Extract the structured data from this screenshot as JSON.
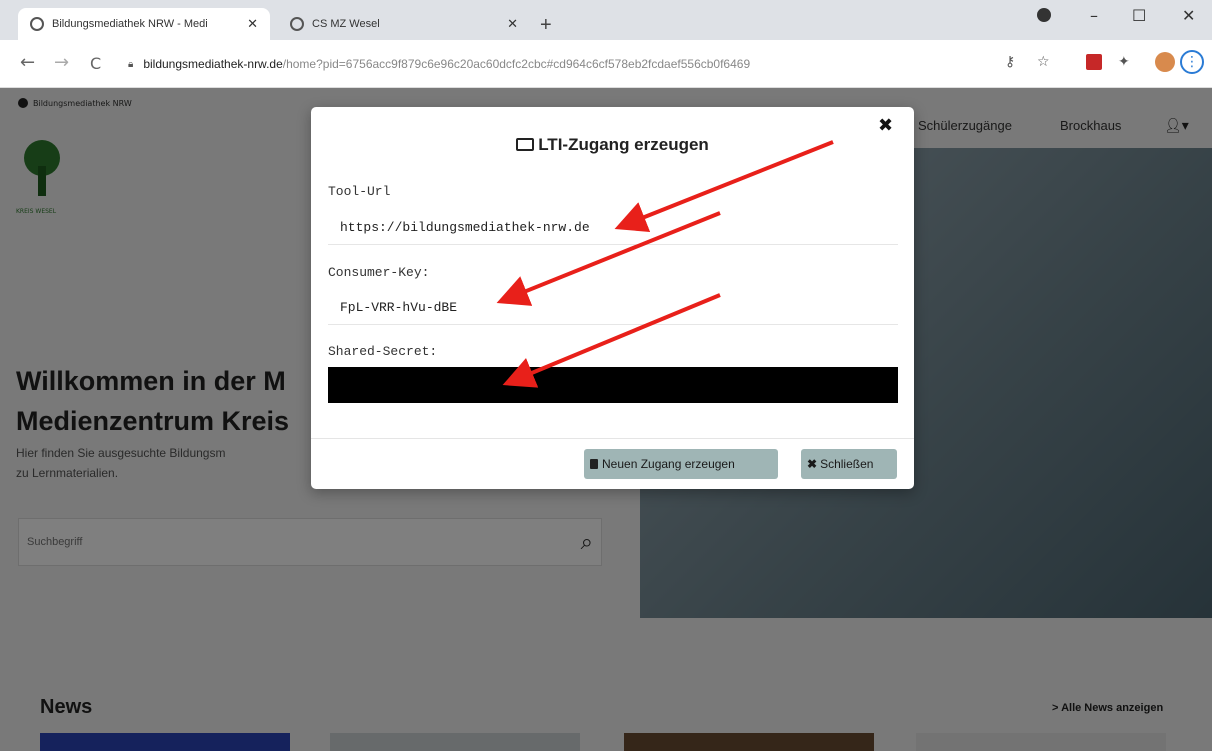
{
  "browser": {
    "tabs": [
      {
        "title": "Bildungsmediathek NRW - Medi"
      },
      {
        "title": "CS MZ Wesel"
      }
    ],
    "url_host": "bildungsmediathek-nrw.de",
    "url_path": "/home?pid=6756acc9f879c6e96c20ac60dcfc2cbc#cd964c6cf578eb2fcdaef556cb0f6469",
    "new_tab": "+",
    "win_min": "–",
    "win_max": "☐",
    "win_close": "✕"
  },
  "site": {
    "name": "Bildungsmediathek NRW",
    "logo_text": "KREIS WESEL",
    "nav": [
      "Schülerzugänge",
      "Brockhaus"
    ],
    "heading_line1": "Willkommen in der M",
    "heading_line2": "Medienzentrum Kreis",
    "subtext_line1": "Hier finden Sie ausgesuchte Bildungsm",
    "subtext_line2": "zu Lernmaterialien.",
    "search_placeholder": "Suchbegriff",
    "news_title": "News",
    "news_all": "> Alle News anzeigen"
  },
  "modal": {
    "title": "LTI-Zugang erzeugen",
    "close_icon": "✖",
    "tool_url_label": "Tool-Url",
    "tool_url_value": "https://bildungsmediathek-nrw.de",
    "consumer_key_label": "Consumer-Key:",
    "consumer_key_value": "FpL-VRR-hVu-dBE",
    "shared_secret_label": "Shared-Secret:",
    "btn_new": "Neuen Zugang erzeugen",
    "btn_close": "Schließen"
  },
  "icons": {
    "monitor": "monitor-icon",
    "trash": "trash-icon",
    "close": "close-icon",
    "search": "search-icon",
    "user": "user-icon"
  },
  "colors": {
    "arrow": "#e8201a",
    "button": "#9fb5b5",
    "overlay": "#000000"
  }
}
